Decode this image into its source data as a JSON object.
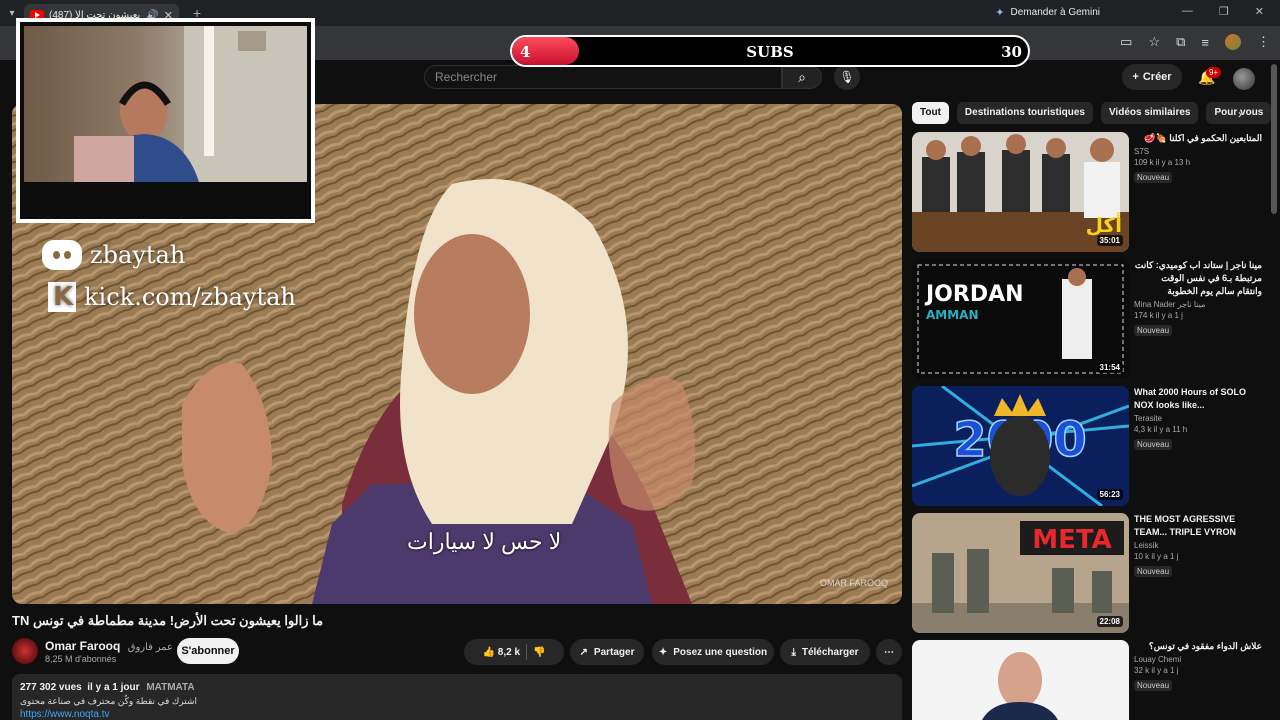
{
  "browser": {
    "tab_title": "ما زالوا يعيشون تحت الأ",
    "tab_badge": "(487)",
    "gemini_label": "Demander à Gemini"
  },
  "subs_goal": {
    "label": "SUBS",
    "current": "4",
    "goal": "30",
    "progress_fraction": 0.13
  },
  "overlay": {
    "discord": "zbaytah",
    "kick": "kick.com/zbaytah"
  },
  "masthead": {
    "search_placeholder": "Rechercher",
    "create_label": "Créer",
    "notif_count": "9+"
  },
  "video": {
    "subtitle": "لا حس لا سيارات",
    "watermark": "OMAR FAROOQ",
    "title": "ما زالوا يعيشون تحت الأرض! مدينة مطماطة في تونس TN",
    "channel": "Omar Farooq",
    "channel_alias": "عمر فاروق",
    "subscribers": "8,25 M d'abonnés",
    "subscribe_label": "S'abonner",
    "likes": "8,2 k",
    "share_label": "Partager",
    "ask_label": "Posez une question",
    "download_label": "Télécharger",
    "views": "277 302 vues",
    "age": "il y a 1 jour",
    "location": "MATMATA",
    "desc_line": "اشترك في نقطة وكُن محترف في صناعة محتوى",
    "link": "https://www.noqta.tv"
  },
  "chips": [
    "Tout",
    "Destinations touristiques",
    "Vidéos similaires",
    "Pour vous"
  ],
  "recommendations": [
    {
      "title": "المتابعين الحكمو في اكلنا 🍖🥩",
      "channel": "S7S",
      "stats": "109 k   il y a 13 h",
      "badge": "Nouveau",
      "duration": "35:01"
    },
    {
      "title": "مينا ناجر | ستاند اب كوميدي: كانت مرتبطة بـ6 في نفس الوقت وانتقام سالم يوم الخطوبة",
      "channel": "Mina Nader مينا ناجر",
      "stats": "174 k   il y a 1 j",
      "badge": "Nouveau",
      "duration": "31:54",
      "thumb_text": "JORDAN",
      "thumb_sub": "AMMAN"
    },
    {
      "title": "What 2000 Hours of SOLO NOX looks like...",
      "channel": "Terasite",
      "stats": "4,3 k   il y a 11 h",
      "badge": "Nouveau",
      "duration": "56:23",
      "thumb_text": "2000"
    },
    {
      "title": "THE MOST AGRESSIVE TEAM... TRIPLE VYRON",
      "channel": "Leissik",
      "stats": "10 k   il y a 1 j",
      "badge": "Nouveau",
      "duration": "22:08",
      "thumb_text": "META"
    },
    {
      "title": "علاش الدواء مفقود في تونس؟",
      "channel": "Louay Chemi",
      "stats": "32 k   il y a 1 j",
      "badge": "Nouveau",
      "duration": ""
    }
  ]
}
